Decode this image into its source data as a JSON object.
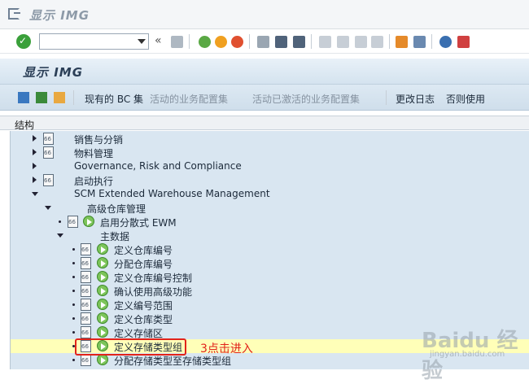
{
  "window": {
    "title": "显示 IMG"
  },
  "screen": {
    "title": "显示 IMG"
  },
  "app_toolbar": {
    "bc_sets": "现有的 BC 集",
    "active_biz": "活动的业务配置集",
    "inactive_biz": "活动已激活的业务配置集",
    "change_log": "更改日志",
    "otherwise": "否则使用"
  },
  "structure": {
    "header": "结构"
  },
  "tree": [
    {
      "label": "销售与分销"
    },
    {
      "label": "物料管理"
    },
    {
      "label": "Governance, Risk and Compliance"
    },
    {
      "label": "启动执行"
    },
    {
      "label": "SCM Extended Warehouse Management"
    },
    {
      "label": "高级仓库管理"
    },
    {
      "label": "启用分散式 EWM"
    },
    {
      "label": "主数据"
    },
    {
      "label": "定义仓库编号"
    },
    {
      "label": "分配仓库编号"
    },
    {
      "label": "定义仓库编号控制"
    },
    {
      "label": "确认使用高级功能"
    },
    {
      "label": "定义编号范围"
    },
    {
      "label": "定义仓库类型"
    },
    {
      "label": "定义存储区"
    },
    {
      "label": "定义存储类型组"
    },
    {
      "label": "分配存储类型至存储类型组"
    }
  ],
  "annotation": {
    "text": "3点击进入",
    "color": "#e2231a"
  },
  "watermark": {
    "text": "Baidu 经验",
    "sub": "jingyan.baidu.com"
  }
}
